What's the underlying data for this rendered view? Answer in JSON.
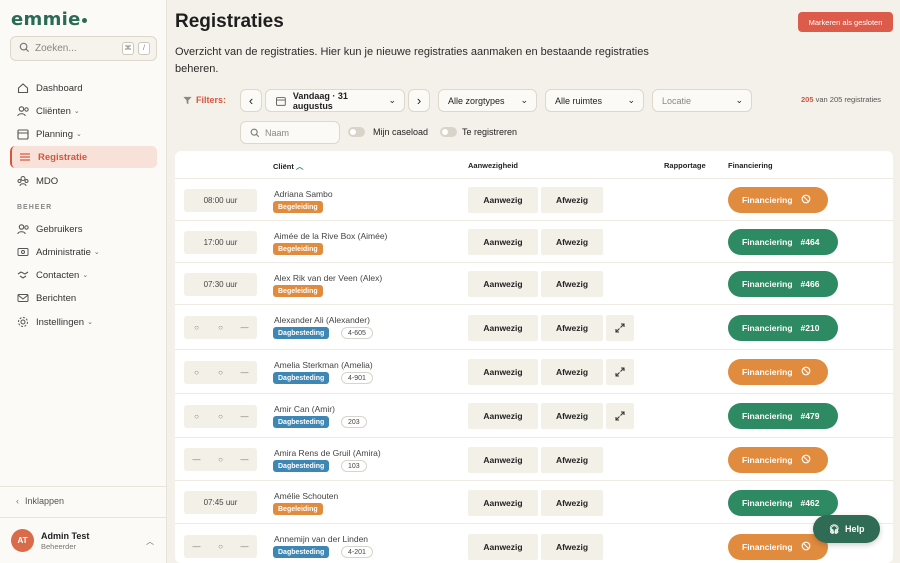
{
  "app": {
    "logo": "emmie"
  },
  "search": {
    "placeholder": "Zoeken...",
    "kbd1": "⌘",
    "kbd2": "/"
  },
  "colors": {
    "accent": "#d4563e",
    "green": "#2e8a62",
    "orange": "#e08b3e",
    "blue": "#3e86b4"
  },
  "sidebar": {
    "items": [
      {
        "label": "Dashboard",
        "icon": "home-icon",
        "chevron": false,
        "active": false
      },
      {
        "label": "Cliënten",
        "icon": "users-icon",
        "chevron": true,
        "active": false
      },
      {
        "label": "Planning",
        "icon": "calendar-icon",
        "chevron": true,
        "active": false
      },
      {
        "label": "Registratie",
        "icon": "list-icon",
        "chevron": false,
        "active": true
      },
      {
        "label": "MDO",
        "icon": "team-icon",
        "chevron": false,
        "active": false
      }
    ],
    "section": "BEHEER",
    "admin_items": [
      {
        "label": "Gebruikers",
        "icon": "users-icon",
        "chevron": false
      },
      {
        "label": "Administratie",
        "icon": "euro-icon",
        "chevron": true
      },
      {
        "label": "Contacten",
        "icon": "handshake-icon",
        "chevron": true
      },
      {
        "label": "Berichten",
        "icon": "mail-icon",
        "chevron": false
      },
      {
        "label": "Instellingen",
        "icon": "gear-icon",
        "chevron": true
      }
    ],
    "collapse": "Inklappen",
    "user": {
      "initials": "AT",
      "name": "Admin Test",
      "role": "Beheerder"
    }
  },
  "page": {
    "title": "Registraties",
    "close_button": "Markeren als gesloten",
    "description": "Overzicht van de registraties. Hier kun je nieuwe registraties aanmaken en bestaande registraties beheren."
  },
  "filters": {
    "label": "Filters:",
    "date": "Vandaag · 31 augustus",
    "zorgtype": "Alle zorgtypes",
    "ruimte": "Alle ruimtes",
    "locatie_placeholder": "Locatie",
    "count_shown": "205",
    "count_total": "van 205 registraties",
    "name_placeholder": "Naam",
    "caseload": "Mijn caseload",
    "te_registreren": "Te registreren"
  },
  "table": {
    "headers": {
      "client": "Cliënt",
      "aanwezigheid": "Aanwezigheid",
      "rapportage": "Rapportage",
      "financiering": "Financiering"
    },
    "present_label": "Aanwezig",
    "absent_label": "Afwezig",
    "fin_label": "Financiering",
    "rows": [
      {
        "time": "08:00 uur",
        "name": "Adriana Sambo",
        "type": "Begeleiding",
        "room": "",
        "report": false,
        "fin": "orange",
        "fin_ref": ""
      },
      {
        "time": "17:00 uur",
        "name": "Aimée de la Rive Box (Aimée)",
        "type": "Begeleiding",
        "room": "",
        "report": false,
        "fin": "green",
        "fin_ref": "#464"
      },
      {
        "time": "07:30 uur",
        "name": "Alex Rik van der Veen (Alex)",
        "type": "Begeleiding",
        "room": "",
        "report": false,
        "fin": "green",
        "fin_ref": "#466"
      },
      {
        "time": "",
        "markers": [
          "○",
          "○",
          "—"
        ],
        "name": "Alexander Ali (Alexander)",
        "type": "Dagbesteding",
        "room": "4-605",
        "report": true,
        "fin": "green",
        "fin_ref": "#210"
      },
      {
        "time": "",
        "markers": [
          "○",
          "○",
          "—"
        ],
        "name": "Amelia Sterkman (Amelia)",
        "type": "Dagbesteding",
        "room": "4-901",
        "report": true,
        "fin": "orange",
        "fin_ref": ""
      },
      {
        "time": "",
        "markers": [
          "○",
          "○",
          "—"
        ],
        "name": "Amir Can (Amir)",
        "type": "Dagbesteding",
        "room": "203",
        "report": true,
        "fin": "green",
        "fin_ref": "#479"
      },
      {
        "time": "",
        "markers": [
          "—",
          "○",
          "—"
        ],
        "name": "Amira Rens de Gruil (Amira)",
        "type": "Dagbesteding",
        "room": "103",
        "report": false,
        "fin": "orange",
        "fin_ref": ""
      },
      {
        "time": "07:45 uur",
        "name": "Amélie Schouten",
        "type": "Begeleiding",
        "room": "",
        "report": false,
        "fin": "green",
        "fin_ref": "#462"
      },
      {
        "time": "",
        "markers": [
          "—",
          "○",
          "—"
        ],
        "name": "Annemijn van der Linden",
        "type": "Dagbesteding",
        "room": "4-201",
        "report": false,
        "fin": "orange",
        "fin_ref": ""
      }
    ]
  },
  "help": {
    "label": "Help"
  }
}
